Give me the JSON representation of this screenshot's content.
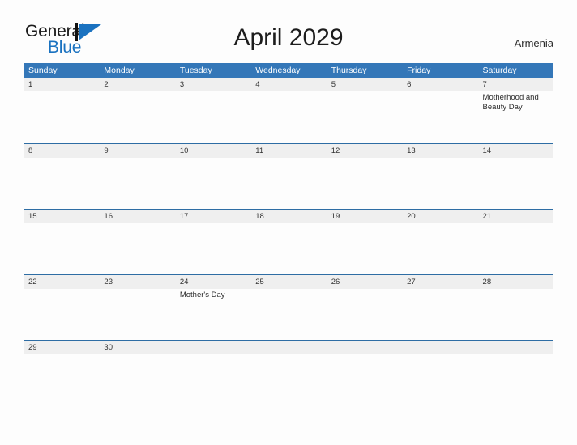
{
  "brand": {
    "name_part1": "General",
    "name_part2": "Blue",
    "logo_icon": "flag-triangle-icon",
    "accent_color": "#1a72c0"
  },
  "header": {
    "title": "April 2029",
    "region": "Armenia"
  },
  "theme": {
    "header_blue": "#3477b8",
    "row_divider": "#2e6da4",
    "daynum_band": "#efefef",
    "page_background": "#fdfdfd"
  },
  "calendar": {
    "weekdays": [
      "Sunday",
      "Monday",
      "Tuesday",
      "Wednesday",
      "Thursday",
      "Friday",
      "Saturday"
    ],
    "weeks": [
      {
        "days": [
          {
            "num": "1",
            "events": []
          },
          {
            "num": "2",
            "events": []
          },
          {
            "num": "3",
            "events": []
          },
          {
            "num": "4",
            "events": []
          },
          {
            "num": "5",
            "events": []
          },
          {
            "num": "6",
            "events": []
          },
          {
            "num": "7",
            "events": [
              "Motherhood and Beauty Day"
            ]
          }
        ]
      },
      {
        "days": [
          {
            "num": "8",
            "events": []
          },
          {
            "num": "9",
            "events": []
          },
          {
            "num": "10",
            "events": []
          },
          {
            "num": "11",
            "events": []
          },
          {
            "num": "12",
            "events": []
          },
          {
            "num": "13",
            "events": []
          },
          {
            "num": "14",
            "events": []
          }
        ]
      },
      {
        "days": [
          {
            "num": "15",
            "events": []
          },
          {
            "num": "16",
            "events": []
          },
          {
            "num": "17",
            "events": []
          },
          {
            "num": "18",
            "events": []
          },
          {
            "num": "19",
            "events": []
          },
          {
            "num": "20",
            "events": []
          },
          {
            "num": "21",
            "events": []
          }
        ]
      },
      {
        "days": [
          {
            "num": "22",
            "events": []
          },
          {
            "num": "23",
            "events": []
          },
          {
            "num": "24",
            "events": [
              "Mother's Day"
            ]
          },
          {
            "num": "25",
            "events": []
          },
          {
            "num": "26",
            "events": []
          },
          {
            "num": "27",
            "events": []
          },
          {
            "num": "28",
            "events": []
          }
        ]
      },
      {
        "days": [
          {
            "num": "29",
            "events": []
          },
          {
            "num": "30",
            "events": []
          },
          {
            "num": "",
            "events": []
          },
          {
            "num": "",
            "events": []
          },
          {
            "num": "",
            "events": []
          },
          {
            "num": "",
            "events": []
          },
          {
            "num": "",
            "events": []
          }
        ]
      }
    ]
  }
}
